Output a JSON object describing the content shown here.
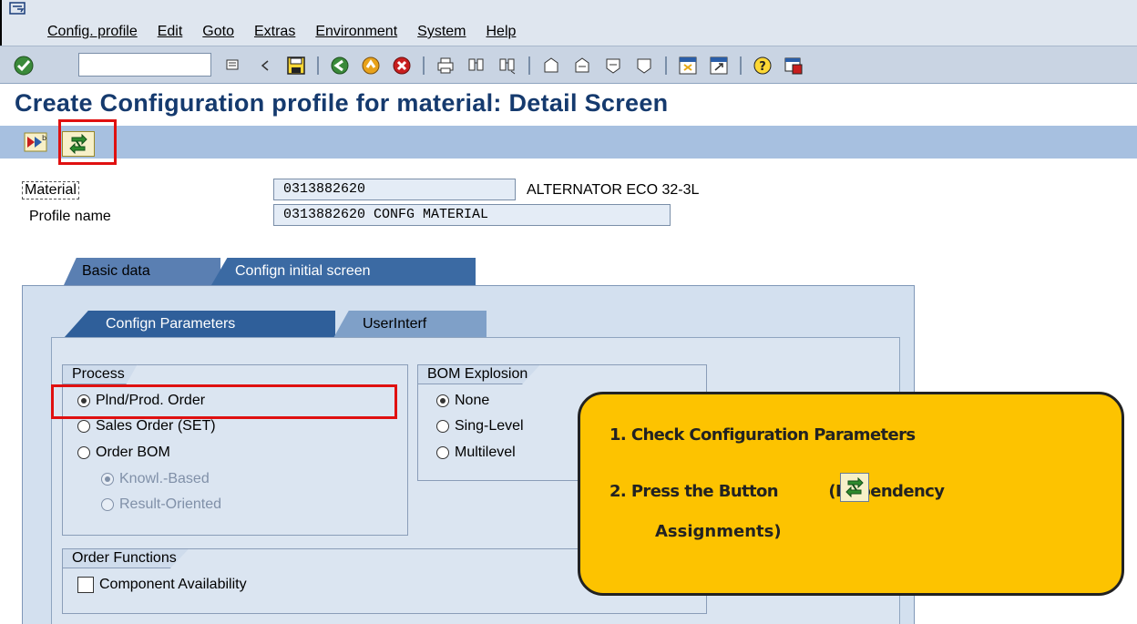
{
  "menubar": {
    "items": [
      "Config. profile",
      "Edit",
      "Goto",
      "Extras",
      "Environment",
      "System",
      "Help"
    ]
  },
  "toolbar": {
    "command_field_value": "",
    "icons": [
      "enter-icon",
      "back-arrow-icon",
      "save-icon",
      "back-icon",
      "exit-icon",
      "cancel-icon",
      "print-icon",
      "find-icon",
      "find-next-icon",
      "first-page-icon",
      "prev-page-icon",
      "next-page-icon",
      "last-page-icon",
      "create-session-icon",
      "shortcut-icon",
      "help-icon",
      "customize-layout-icon"
    ]
  },
  "page": {
    "title": "Create Configuration profile for material: Detail Screen"
  },
  "fields": {
    "material_label": "Material",
    "material_value": "0313882620",
    "material_desc": "ALTERNATOR ECO 32-3L",
    "profile_label": "Profile name",
    "profile_value": "0313882620 CONFG MATERIAL"
  },
  "tabs": {
    "outer": [
      "Basic data",
      "Confign initial screen"
    ],
    "inner": [
      "Confign Parameters",
      "UserInterf"
    ]
  },
  "process": {
    "title": "Process",
    "options": [
      {
        "label": "Plnd/Prod. Order",
        "selected": true
      },
      {
        "label": "Sales Order (SET)",
        "selected": false
      },
      {
        "label": "Order BOM",
        "selected": false
      },
      {
        "label": "Knowl.-Based",
        "selected": true,
        "disabled": true
      },
      {
        "label": "Result-Oriented",
        "selected": false,
        "disabled": true
      }
    ]
  },
  "bom": {
    "title": "BOM Explosion",
    "options": [
      {
        "label": "None",
        "selected": true
      },
      {
        "label": "Sing-Level",
        "selected": false
      },
      {
        "label": "Multilevel",
        "selected": false
      }
    ]
  },
  "order_functions": {
    "title": "Order Functions",
    "component_availability": "Component Availability",
    "checked": false
  },
  "callout": {
    "step1": "1. Check Configuration Parameters",
    "step2": "2. Press the Button",
    "step2_suffix": "(Dependency",
    "step2_cont": "Assignments)",
    "color": "#fdc300"
  }
}
